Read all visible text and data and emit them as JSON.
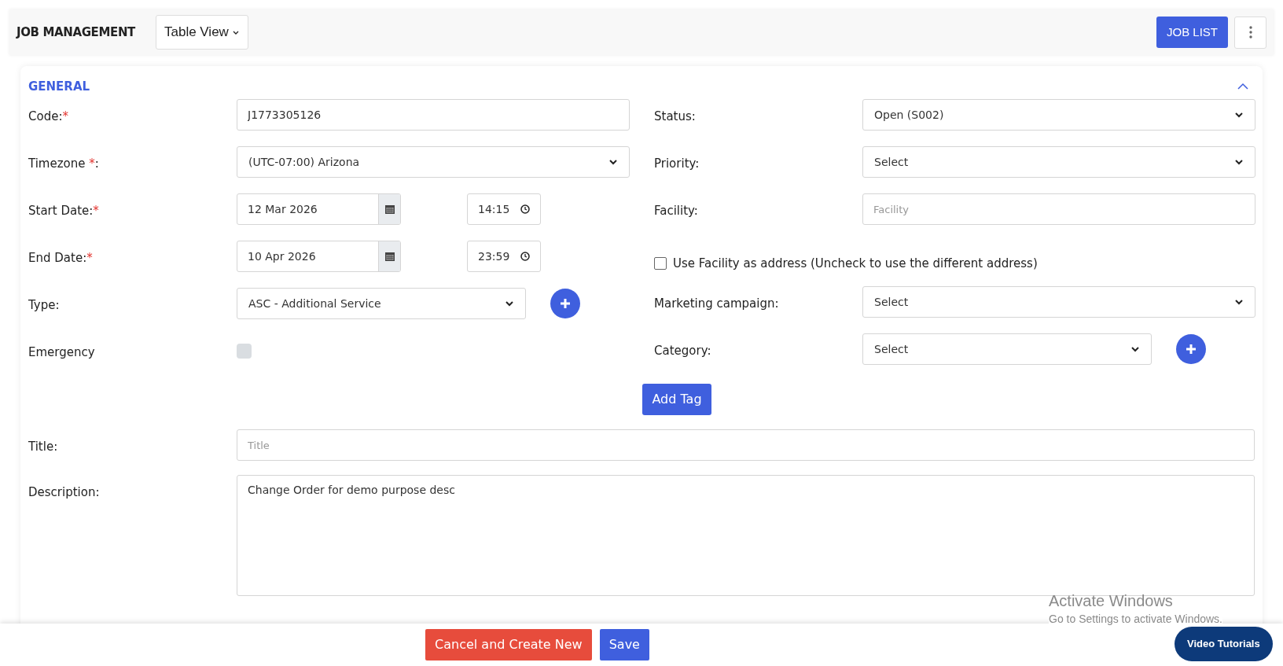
{
  "header": {
    "title": "JOB MANAGEMENT",
    "view_select": "Table View",
    "job_list_button": "JOB LIST"
  },
  "section": {
    "title": "GENERAL",
    "expanded": true
  },
  "left_fields": [
    {
      "kind": "text",
      "label": "Code:",
      "required_mark": "*",
      "value": "J1773305126"
    },
    {
      "kind": "select",
      "label": "Timezone ",
      "required_mark": "*",
      "label_after": ":",
      "value": "(UTC-07:00) Arizona"
    },
    {
      "kind": "datetime",
      "label": "Start Date:",
      "required_mark": "*",
      "date": "12 Mar 2026",
      "time": "14:15"
    },
    {
      "kind": "datetime",
      "label": "End Date:",
      "required_mark": "*",
      "date": "10 Apr 2026",
      "time": "23:59"
    },
    {
      "kind": "select_add",
      "label": "Type:",
      "value": "ASC - Additional Service"
    },
    {
      "kind": "checkbox",
      "label": "Emergency",
      "checked": false
    }
  ],
  "right_fields": [
    {
      "kind": "select",
      "label": "Status:",
      "value": "Open (S002)"
    },
    {
      "kind": "select",
      "label": "Priority:",
      "value": "Select"
    },
    {
      "kind": "text",
      "label": "Facility:",
      "placeholder": "Facility"
    },
    {
      "kind": "check_row",
      "label": "Use Facility as address (Uncheck to use the different address)",
      "checked": false
    },
    {
      "kind": "select",
      "label": "Marketing campaign:",
      "value": "Select"
    },
    {
      "kind": "select_add",
      "label": "Category:",
      "value": "Select"
    }
  ],
  "add_tag_button": "Add Tag",
  "wide_fields": [
    {
      "kind": "text",
      "label": "Title:",
      "placeholder": "Title"
    },
    {
      "kind": "textarea",
      "label": "Description:",
      "value": "Change Order for demo purpose desc"
    }
  ],
  "footer": {
    "cancel_button": "Cancel and Create New",
    "save_button": "Save",
    "help_button": "Video Tutorials"
  },
  "os_notice": {
    "title": "Activate Windows",
    "subtitle": "Go to Settings to activate Windows."
  }
}
